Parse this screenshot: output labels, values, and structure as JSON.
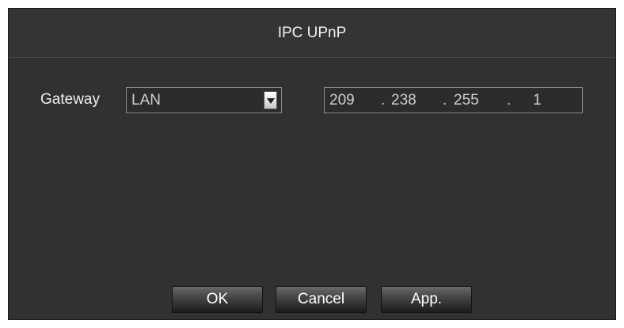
{
  "dialog": {
    "title": "IPC UPnP"
  },
  "gateway": {
    "label": "Gateway",
    "selected": "LAN",
    "ip": [
      "209",
      "238",
      "255",
      "1"
    ],
    "separator": "."
  },
  "buttons": {
    "ok": "OK",
    "cancel": "Cancel",
    "apply": "App."
  },
  "icons": {
    "dropdown": "triangle-down-icon"
  }
}
